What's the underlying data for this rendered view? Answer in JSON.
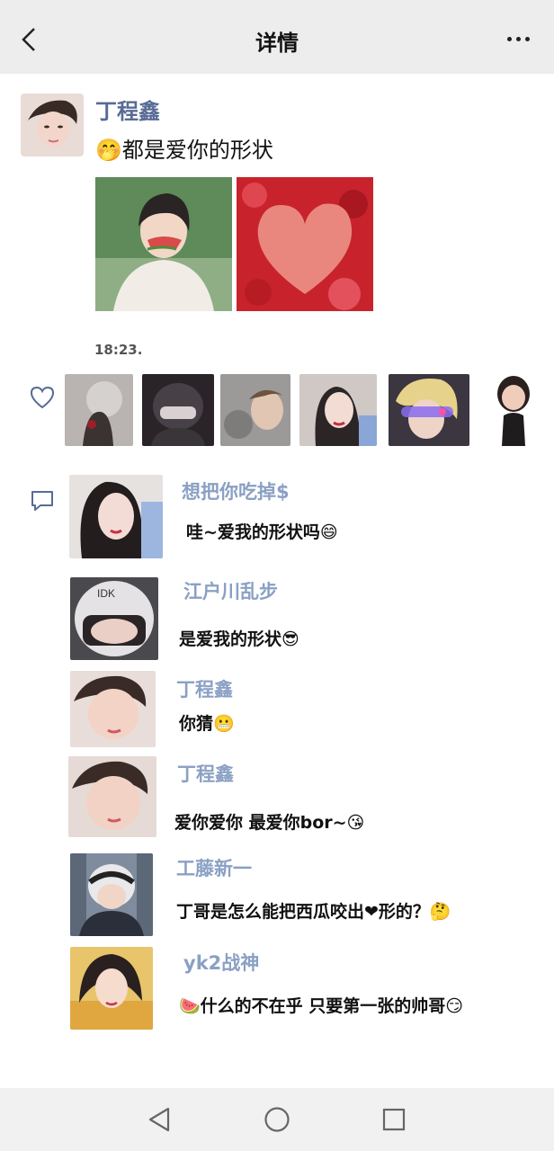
{
  "header": {
    "title": "详情"
  },
  "post": {
    "author": "丁程鑫",
    "text": "🤭都是爱你的形状",
    "timestamp": "18:23."
  },
  "comments": [
    {
      "name": "想把你吃掉$",
      "text": "哇~爱我的形状吗😄"
    },
    {
      "name": "江户川乱步",
      "text": "是爱我的形状😎"
    },
    {
      "name": "丁程鑫",
      "text": "你猜😬"
    },
    {
      "name": "丁程鑫",
      "text": "爱你爱你 最爱你bor~😘"
    },
    {
      "name": "工藤新一",
      "text": "丁哥是怎么能把西瓜咬出❤形的？🤔"
    },
    {
      "name": "yk2战神",
      "text": "🍉什么的不在乎 只要第一张的帅哥😏"
    }
  ],
  "icons": {
    "back": "chevron-left-icon",
    "more": "more-dots-icon",
    "like": "heart-outline-icon",
    "comment": "comment-bubble-icon",
    "nav_back": "triangle-back-icon",
    "nav_home": "circle-home-icon",
    "nav_recent": "square-recent-icon"
  },
  "colors": {
    "topbar_bg": "#ededed",
    "author_name": "#576b95",
    "comment_name": "#8aa0c4",
    "navbar_bg": "#f1f1f1"
  }
}
